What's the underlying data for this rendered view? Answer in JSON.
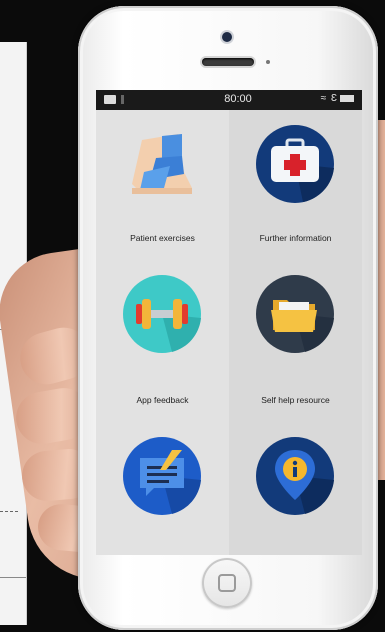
{
  "statusbar": {
    "time": "80:00",
    "signal": "≈ Ɛ",
    "battery_icon": "battery-icon"
  },
  "tiles": [
    {
      "label": "Patient exercises",
      "icon": "bandaged-foot-icon"
    },
    {
      "label": "Further information",
      "icon": "first-aid-kit-icon"
    },
    {
      "label": "App feedback",
      "icon": "dumbbell-icon"
    },
    {
      "label": "Self help resource",
      "icon": "folder-icon"
    },
    {
      "label": "",
      "icon": "message-edit-icon"
    },
    {
      "label": "",
      "icon": "info-location-icon"
    }
  ],
  "colors": {
    "teal": "#3ec9c7",
    "navy": "#123a7a",
    "dark_slate": "#2f3b4a",
    "red": "#d8222b",
    "blue": "#2d6dd6",
    "folder_yellow": "#f5c242"
  }
}
